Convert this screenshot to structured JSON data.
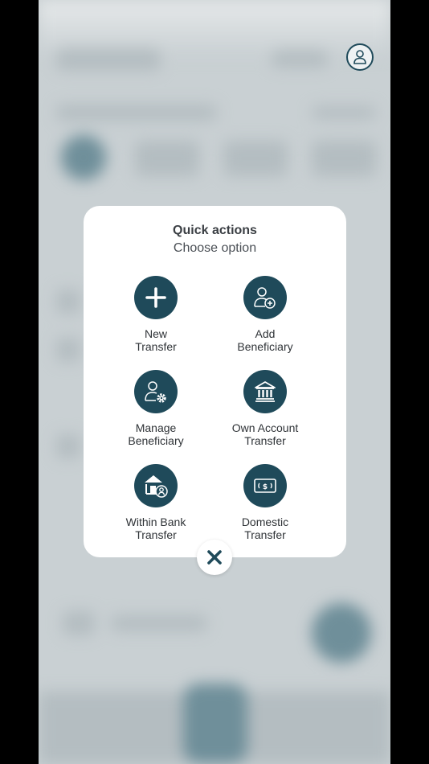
{
  "modal": {
    "title": "Quick actions",
    "subtitle": "Choose option",
    "actions": [
      {
        "line1": "New",
        "line2": "Transfer",
        "icon": "plus-icon"
      },
      {
        "line1": "Add",
        "line2": "Beneficiary",
        "icon": "add-user-icon"
      },
      {
        "line1": "Manage",
        "line2": "Beneficiary",
        "icon": "manage-user-icon"
      },
      {
        "line1": "Own Account",
        "line2": "Transfer",
        "icon": "bank-icon"
      },
      {
        "line1": "Within Bank",
        "line2": "Transfer",
        "icon": "bank-user-icon"
      },
      {
        "line1": "Domestic",
        "line2": "Transfer",
        "icon": "cash-icon"
      }
    ]
  },
  "colors": {
    "accent": "#1f4a5a",
    "sheet": "#ffffff",
    "overlay": "#c9d0d3"
  },
  "header": {
    "profile_icon": "user-icon"
  },
  "close_icon": "close-icon"
}
